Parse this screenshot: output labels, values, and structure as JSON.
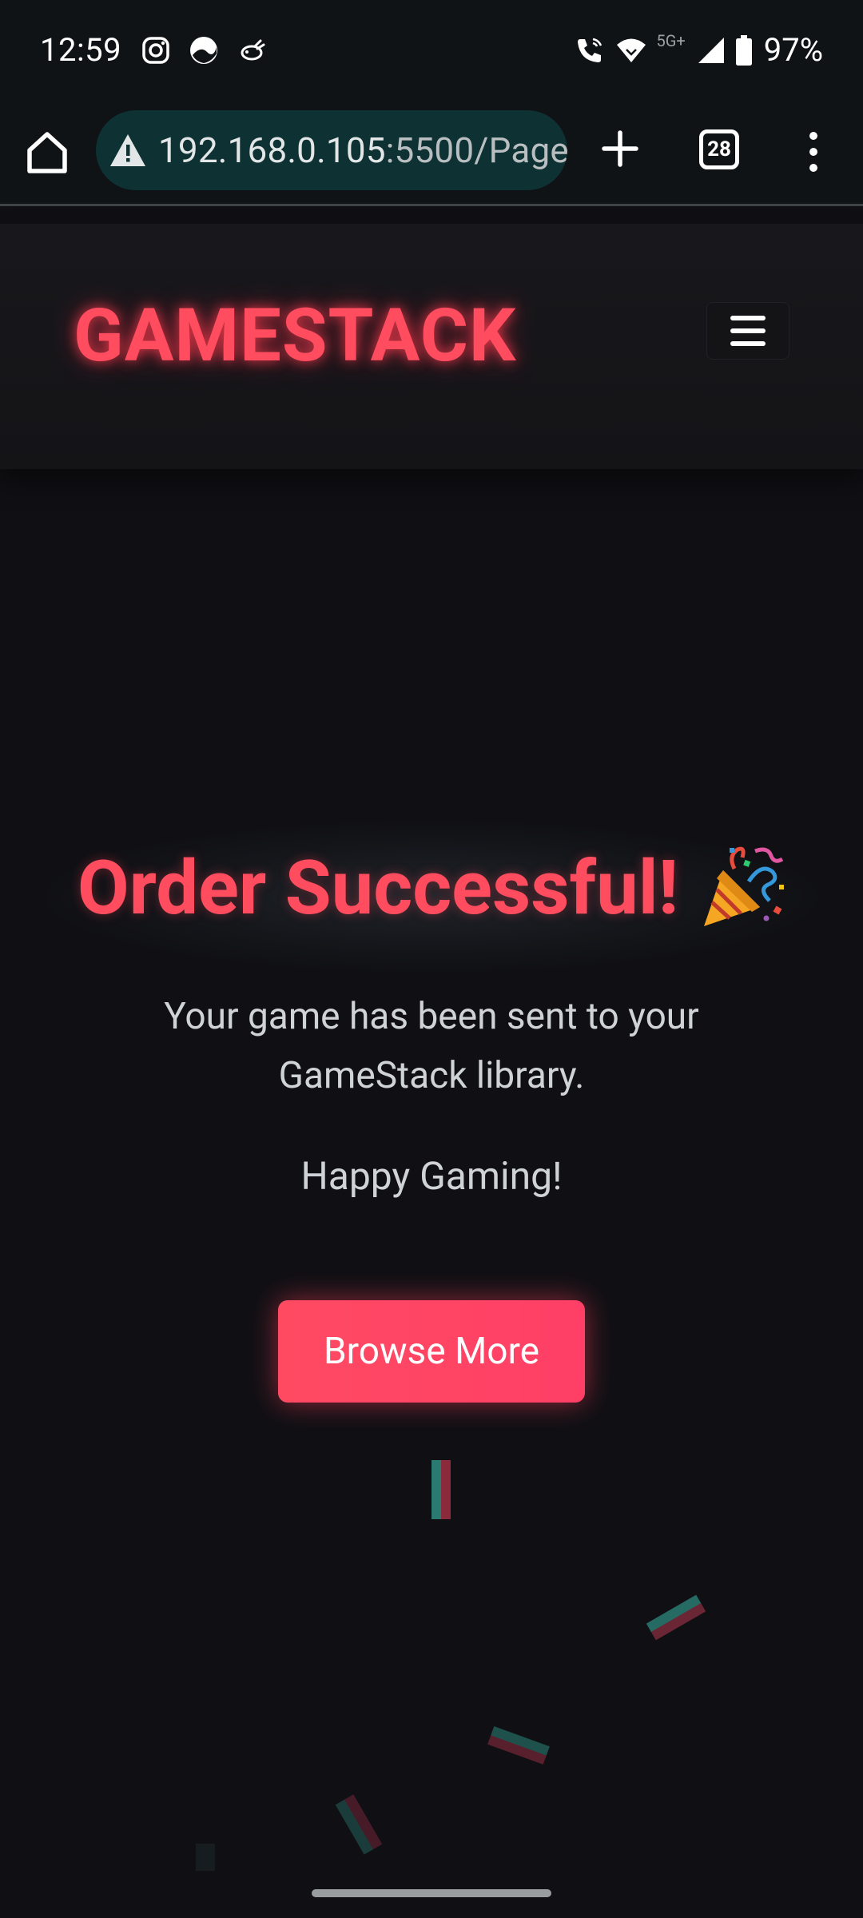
{
  "status_bar": {
    "time": "12:59",
    "battery": "97%",
    "network": "5G+",
    "app_icons": [
      "instagram-icon",
      "app-circle-icon",
      "bird-icon"
    ],
    "system_icons": [
      "wifi-call-icon",
      "wifi-icon",
      "signal-icon",
      "battery-icon"
    ]
  },
  "browser": {
    "url_prefix": "192.168.0.105",
    "url_suffix": ":5500/Page",
    "tab_count": "28",
    "icons": [
      "home-icon",
      "warning-icon",
      "plus-icon",
      "tabs-icon",
      "menu-dots-icon"
    ]
  },
  "site": {
    "logo": "GAMESTACK",
    "menu_icon": "hamburger-icon"
  },
  "content": {
    "title": "Order Successful!",
    "title_icon": "party-popper-icon",
    "message": "Your game has been sent to your GameStack library.",
    "sub_message": "Happy Gaming!",
    "button_label": "Browse More"
  },
  "colors": {
    "accent": "#ff4d5f",
    "button": "#ff4563",
    "background": "#101014",
    "text": "#cfd2d6",
    "url_pill": "#0e3133"
  }
}
